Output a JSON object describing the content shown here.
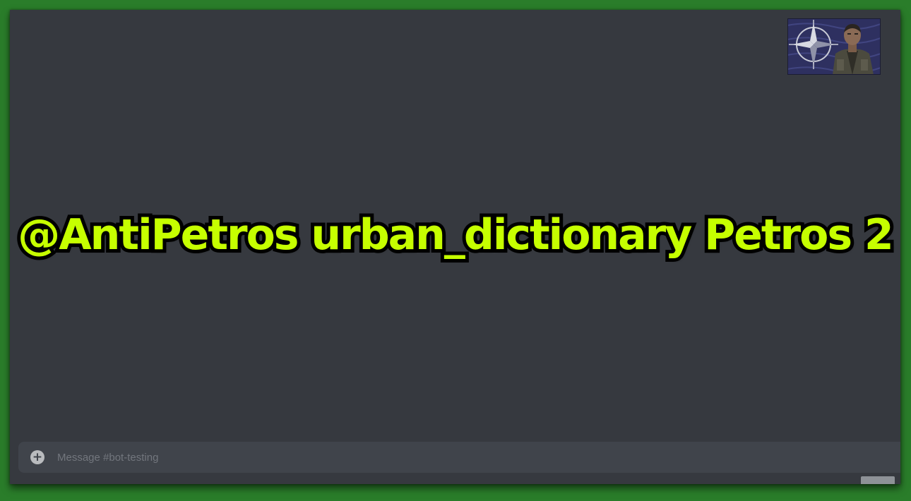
{
  "overlay": {
    "caption": "@AntiPetros urban_dictionary Petros 2",
    "caption_color": "#c6ff00",
    "caption_outline_color": "#000000"
  },
  "window": {
    "background": "#36393f",
    "avatar_icon": "nato-star-portrait-icon"
  },
  "composer": {
    "placeholder": "Message #bot-testing",
    "value": "",
    "attach_icon": "plus-circle-icon"
  }
}
